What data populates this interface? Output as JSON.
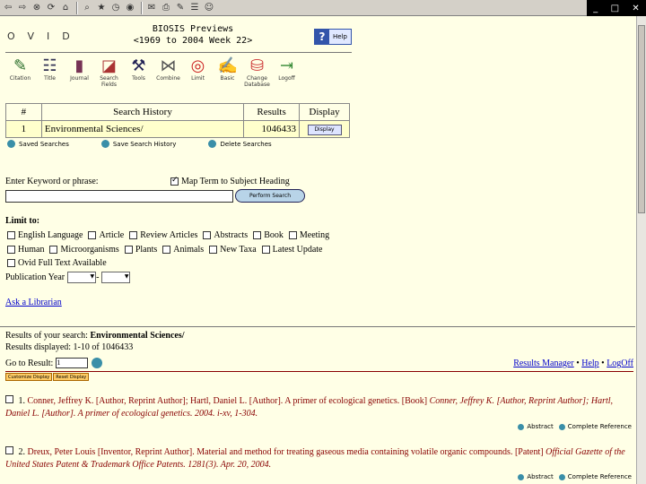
{
  "window": {
    "controls": [
      "_",
      "□",
      "✕"
    ]
  },
  "header": {
    "logo": "OVID",
    "db_title": "BIOSIS Previews",
    "db_range": "<1969 to 2004 Week 22>",
    "help_label": "Help"
  },
  "toolbar": [
    {
      "label": "Citation",
      "icon": "pencil-icon",
      "glyph": "✎",
      "color": "#2a6e2a"
    },
    {
      "label": "Title",
      "icon": "list-icon",
      "glyph": "☷",
      "color": "#335"
    },
    {
      "label": "Journal",
      "icon": "book-icon",
      "glyph": "▮",
      "color": "#735"
    },
    {
      "label": "Search Fields",
      "icon": "search-fields-icon",
      "glyph": "◪",
      "color": "#a33"
    },
    {
      "label": "Tools",
      "icon": "wrench-icon",
      "glyph": "⚒",
      "color": "#225"
    },
    {
      "label": "Combine",
      "icon": "combine-icon",
      "glyph": "⋈",
      "color": "#555"
    },
    {
      "label": "Limit",
      "icon": "target-icon",
      "glyph": "◎",
      "color": "#c22"
    },
    {
      "label": "Basic",
      "icon": "basic-icon",
      "glyph": "✍",
      "color": "#666"
    },
    {
      "label": "Change Database",
      "icon": "database-icon",
      "glyph": "⛁",
      "color": "#c33"
    },
    {
      "label": "Logoff",
      "icon": "logoff-icon",
      "glyph": "⇥",
      "color": "#383"
    }
  ],
  "history": {
    "headers": [
      "#",
      "Search History",
      "Results",
      "Display"
    ],
    "rows": [
      {
        "num": "1",
        "query": "Environmental Sciences/",
        "results": "1046433",
        "display": "Display"
      }
    ]
  },
  "history_actions": [
    "Saved Searches",
    "Save Search History",
    "Delete Searches"
  ],
  "search": {
    "keyword_label": "Enter Keyword or phrase:",
    "map_term": "Map Term to Subject Heading",
    "keyword_value": "",
    "perform_label": "Perform Search"
  },
  "limits": {
    "label": "Limit to:",
    "row1": [
      "English Language",
      "Article",
      "Review Articles",
      "Abstracts",
      "Book",
      "Meeting"
    ],
    "row2": [
      "Human",
      "Microorganisms",
      "Plants",
      "Animals",
      "New Taxa",
      "Latest Update"
    ],
    "row3": [
      "Ovid Full Text Available"
    ],
    "pub_year_label": "Publication Year",
    "pub_year_sep": "-"
  },
  "ask_librarian": "Ask a Librarian",
  "results": {
    "results_of_prefix": "Results of your search: ",
    "query": "Environmental Sciences/",
    "displayed": "Results displayed: 1-10 of 1046433",
    "goto_label": "Go to Result:",
    "goto_value": "1",
    "links": [
      "Results Manager",
      "Help",
      "LogOff"
    ],
    "display_buttons": [
      "Customize Display",
      "Reset Display"
    ],
    "records": [
      {
        "num": "1.",
        "authors": "Conner, Jeffrey K. [Author, Reprint Author]; Hartl, Daniel L. [Author].",
        "title": " A primer of ecological genetics. [Book] ",
        "source": "Conner, Jeffrey K. [Author, Reprint Author]; Hartl, Daniel L. [Author]. A primer of ecological genetics. 2004. i-xv, 1-304.",
        "abstract": "Abstract",
        "complete": "Complete Reference"
      },
      {
        "num": "2.",
        "authors": "Dreux, Peter Louis [Inventor, Reprint Author].",
        "title": " Material and method for treating gaseous media containing volatile organic compounds. [Patent] ",
        "source": "Official Gazette of the United States Patent & Trademark Office Patents. 1281(3). Apr. 20, 2004.",
        "abstract": "Abstract",
        "complete": "Complete Reference"
      }
    ]
  }
}
